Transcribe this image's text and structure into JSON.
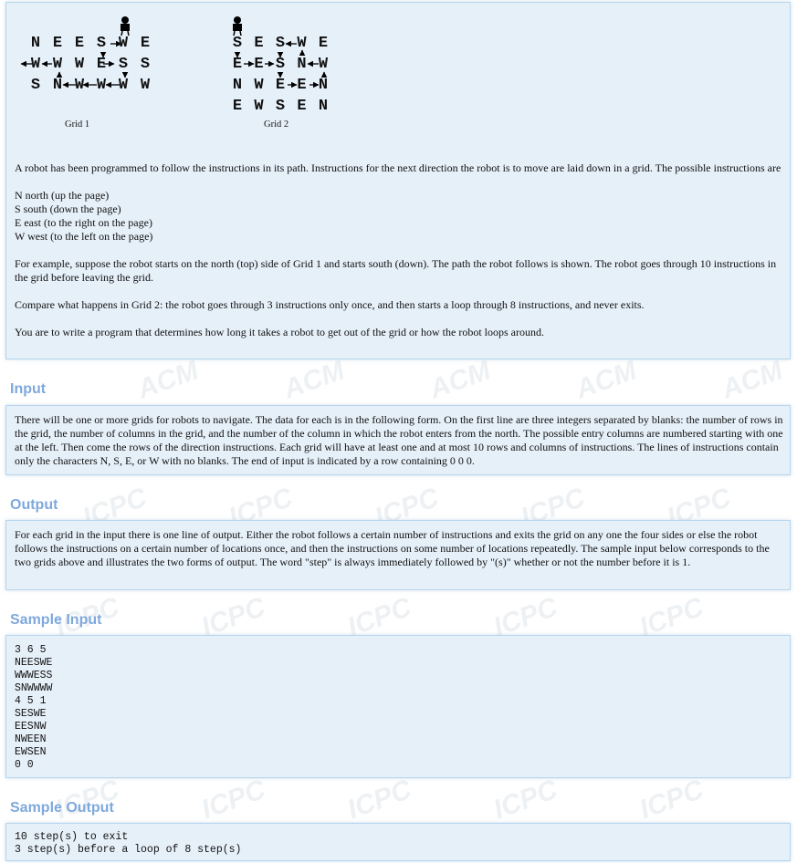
{
  "figure": {
    "grid1": {
      "rows": [
        "NEESWE",
        "WWWESS",
        "SNWWWW"
      ],
      "caption": "Grid 1"
    },
    "grid2": {
      "rows": [
        "SESWE",
        "EESNW",
        "NWEEN",
        "EWSEN"
      ],
      "caption": "Grid 2"
    }
  },
  "intro": {
    "p1": "A robot has been programmed to follow the instructions in its path. Instructions for the next direction the robot is to move are laid down in a grid. The possible instructions are",
    "dirs": [
      "N north (up the page)",
      "S south (down the page)",
      "E east (to the right on the page)",
      "W west (to the left on the page)"
    ],
    "p2": "For example, suppose the robot starts on the north (top) side of Grid 1 and starts south (down). The path the robot follows is shown. The robot goes through 10 instructions in the grid before leaving the grid.",
    "p3": "Compare what happens in Grid 2: the robot goes through 3 instructions only once, and then starts a loop through 8 instructions, and never exits.",
    "p4": "You are to write a program that determines how long it takes a robot to get out of the grid or how the robot loops around."
  },
  "input": {
    "title": "Input",
    "text": "There will be one or more grids for robots to navigate. The data for each is in the following form. On the first line are three integers separated by blanks: the number of rows in the grid, the number of columns in the grid, and the number of the column in which the robot enters from the north. The possible entry columns are numbered starting with one at the left. Then come the rows of the direction instructions. Each grid will have at least one and at most 10 rows and columns of instructions. The lines of instructions contain only the characters N, S, E, or W with no blanks. The end of input is indicated by a row containing 0 0 0."
  },
  "output": {
    "title": "Output",
    "text": "For each grid in the input there is one line of output. Either the robot follows a certain number of instructions and exits the grid on any one the four sides or else the robot follows the instructions on a certain number of locations once, and then the instructions on some number of locations repeatedly. The sample input below corresponds to the two grids above and illustrates the two forms of output. The word \"step\" is always immediately followed by \"(s)\" whether or not the number before it is 1."
  },
  "sample_input": {
    "title": "Sample Input",
    "text": "3 6 5\nNEESWE\nWWWESS\nSNWWWW\n4 5 1\nSESWE\nEESNW\nNWEEN\nEWSEN\n0 0"
  },
  "sample_output": {
    "title": "Sample Output",
    "text": "10 step(s) to exit\n3 step(s) before a loop of 8 step(s)"
  }
}
